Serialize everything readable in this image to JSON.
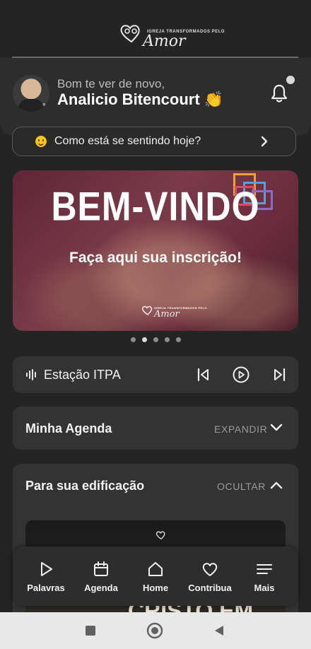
{
  "header": {
    "logo_tag": "IGREJA TRANSFORMADOS PELO",
    "logo_script": "Amor"
  },
  "greeting": {
    "subtitle": "Bom te ver de novo,",
    "name": "Analicio Bitencourt 👏"
  },
  "mood": {
    "label": "Como está se sentindo hoje?"
  },
  "banner": {
    "title": "BEM-VINDO",
    "subtitle": "Faça aqui sua inscrição!",
    "logo_tag": "IGREJA TRANSFORMADOS PELO",
    "logo_script": "Amor",
    "slides": 5,
    "active_slide": 2
  },
  "radio": {
    "title": "Estação ITPA"
  },
  "agenda": {
    "title": "Minha Agenda",
    "action": "EXPANDIR"
  },
  "edification": {
    "title": "Para sua edificação",
    "action": "OCULTAR",
    "video_text": "CRISTO EM NÓS"
  },
  "nav": {
    "items": [
      {
        "label": "Palavras",
        "icon": "play-icon"
      },
      {
        "label": "Agenda",
        "icon": "calendar-icon"
      },
      {
        "label": "Home",
        "icon": "home-icon"
      },
      {
        "label": "Contribua",
        "icon": "heart-icon"
      },
      {
        "label": "Mais",
        "icon": "menu-icon"
      }
    ]
  },
  "colors": {
    "background": "#242424",
    "card": "#333333",
    "banner": "#6a2c3d"
  }
}
